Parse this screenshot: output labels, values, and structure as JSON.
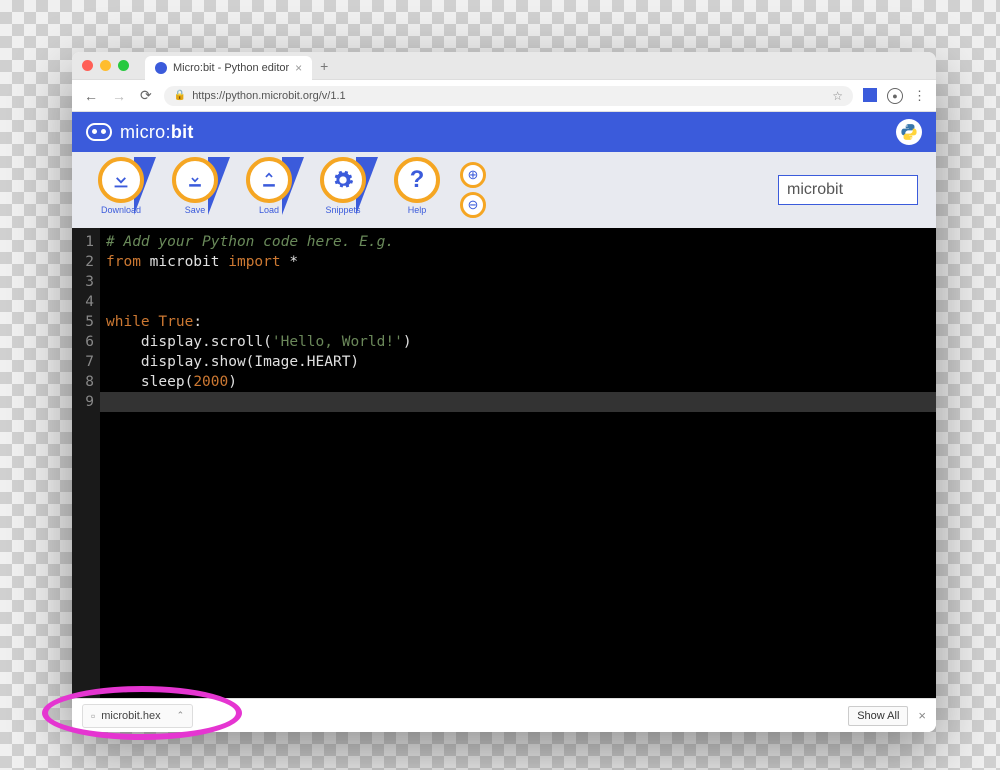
{
  "browser": {
    "tab_title": "Micro:bit - Python editor",
    "url": "https://python.microbit.org/v/1.1",
    "new_tab": "+"
  },
  "header": {
    "brand_thin": "micro:",
    "brand_bold": "bit"
  },
  "toolbar": {
    "download": "Download",
    "save": "Save",
    "load": "Load",
    "snippets": "Snippets",
    "help": "Help",
    "zoom_in_glyph": "⊕",
    "zoom_out_glyph": "⊖",
    "script_name_value": "microbit"
  },
  "editor": {
    "lines": [
      {
        "n": "1",
        "segments": [
          {
            "cls": "comment",
            "t": "# Add your Python code here. E.g."
          }
        ]
      },
      {
        "n": "2",
        "segments": [
          {
            "cls": "kw",
            "t": "from "
          },
          {
            "cls": "ident",
            "t": "microbit"
          },
          {
            "cls": "kw",
            "t": " import "
          },
          {
            "cls": "ident",
            "t": "*"
          }
        ]
      },
      {
        "n": "3",
        "segments": []
      },
      {
        "n": "4",
        "segments": []
      },
      {
        "n": "5",
        "segments": [
          {
            "cls": "kw",
            "t": "while "
          },
          {
            "cls": "kw",
            "t": "True"
          },
          {
            "cls": "ident",
            "t": ":"
          }
        ]
      },
      {
        "n": "6",
        "segments": [
          {
            "cls": "ident",
            "t": "    display.scroll("
          },
          {
            "cls": "str",
            "t": "'Hello, World!'"
          },
          {
            "cls": "ident",
            "t": ")"
          }
        ]
      },
      {
        "n": "7",
        "segments": [
          {
            "cls": "ident",
            "t": "    display.show(Image.HEART)"
          }
        ]
      },
      {
        "n": "8",
        "segments": [
          {
            "cls": "ident",
            "t": "    sleep("
          },
          {
            "cls": "num",
            "t": "2000"
          },
          {
            "cls": "ident",
            "t": ")"
          }
        ]
      },
      {
        "n": "9",
        "segments": []
      }
    ],
    "current_line_index": 8
  },
  "downloads": {
    "filename": "microbit.hex",
    "show_all": "Show All"
  }
}
